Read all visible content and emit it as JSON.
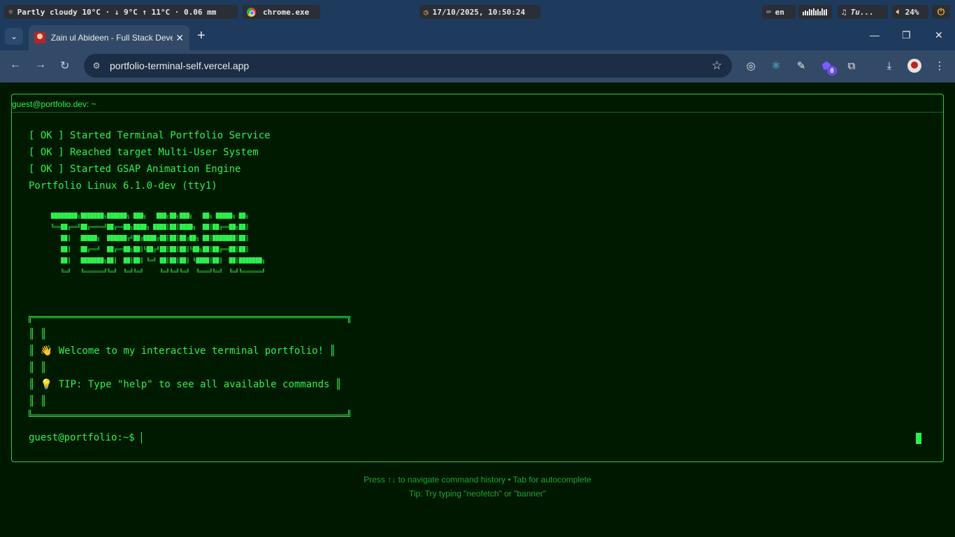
{
  "os_bar": {
    "weather": "Partly cloudy 10°C · ↓ 9°C ↑ 11°C · 0.06 mm",
    "weather_icon": "sun-icon",
    "active_app": "chrome.exe",
    "datetime": "17/10/2025, 10:50:24",
    "keyboard_lang": "en",
    "music": "Tu...",
    "volume": "24%"
  },
  "browser": {
    "tab_title": "Zain ul Abideen - Full Stack Developer",
    "url": "portfolio-terminal-self.vercel.app",
    "extension_badge": "8"
  },
  "terminal": {
    "header": "guest@portfolio.dev: ~",
    "boot_lines": [
      "[ OK ] Started Terminal Portfolio Service",
      "[ OK ] Reached target Multi-User System",
      "[ OK ] Started GSAP Animation Engine",
      "Portfolio Linux 6.1.0-dev (tty1)"
    ],
    "banner_lines": [
      "████████╗███████╗██████╗ ███╗   ███╗██╗███╗   ██╗ █████╗ ██╗",
      "╚══██╔══╝██╔════╝██╔══██╗████╗ ████║██║████╗  ██║██╔══██╗██║",
      "   ██║   █████╗  ██████╔╝██╔████╔██║██║██╔██╗ ██║███████║██║",
      "   ██║   ██╔══╝  ██╔══██╗██║╚██╔╝██║██║██║╚██╗██║██╔══██║██║",
      "   ██║   ███████╗██║  ██║██║ ╚═╝ ██║██║██║ ╚████║██║  ██║███████╗",
      "   ╚═╝   ╚══════╝╚═╝  ╚═╝╚═╝     ╚═╝╚═╝╚═╝  ╚═══╝╚═╝  ╚═╝╚══════╝"
    ],
    "box_lines": [
      "║ ║",
      "║ 👋 Welcome to my interactive terminal portfolio! ║",
      "║ ║",
      "║ 💡 TIP: Type \"help\" to see all available commands ║",
      "║ ║"
    ],
    "prompt": "guest@portfolio:~$ ",
    "input_value": ""
  },
  "hints": {
    "line1": "Press ↑↓ to navigate command history • Tab for autocomplete",
    "line2": "Tip: Try typing \"neofetch\" or \"banner\""
  }
}
